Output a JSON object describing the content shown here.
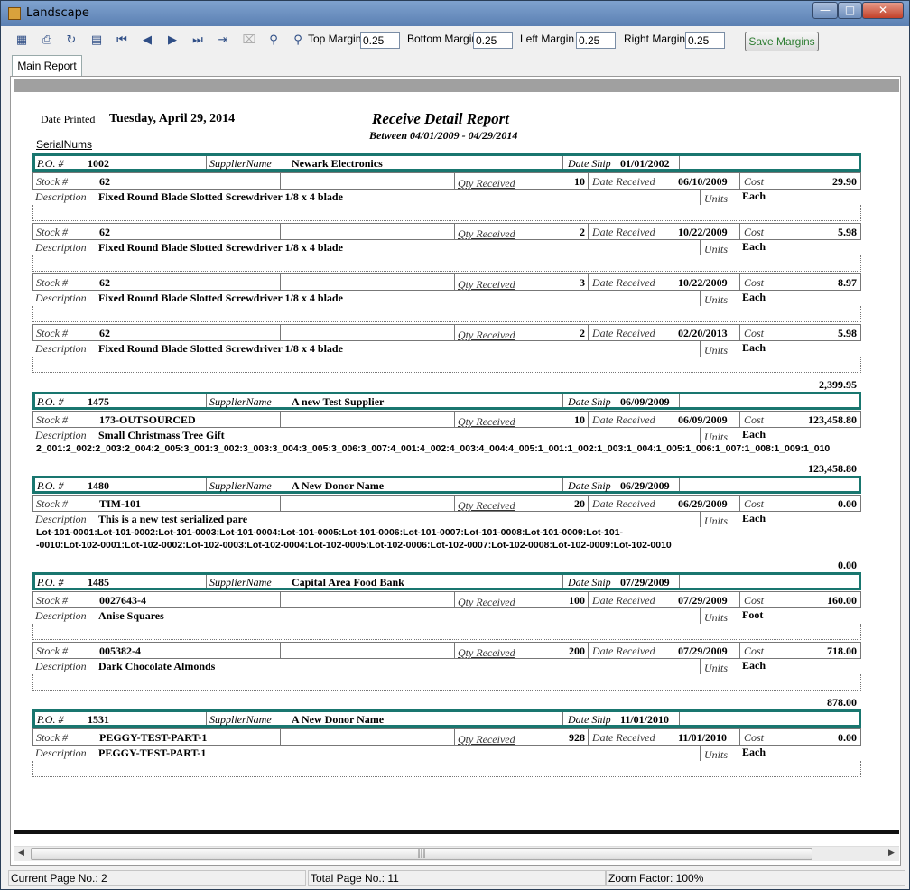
{
  "window": {
    "title": "Landscape"
  },
  "toolbar": {
    "top_margin_label": "Top Margin",
    "top_margin_value": "0.25",
    "bottom_margin_label": "Bottom Margin",
    "bottom_margin_value": "0.25",
    "left_margin_label": "Left Margin",
    "left_margin_value": "0.25",
    "right_margin_label": "Right Margin",
    "right_margin_value": "0.25",
    "save_label": "Save Margins",
    "icons": [
      "export-icon",
      "print-icon",
      "refresh-icon",
      "tree-icon",
      "first-page-icon",
      "prev-page-icon",
      "next-page-icon",
      "last-page-icon",
      "goto-icon",
      "stop-icon",
      "find-icon",
      "find-next-icon"
    ]
  },
  "tabs": [
    "Main Report"
  ],
  "report": {
    "date_printed_label": "Date Printed",
    "date_printed": "Tuesday, April 29, 2014",
    "title": "Receive Detail Report",
    "subtitle": "Between 04/01/2009 - 04/29/2014",
    "serial_label": "SerialNums",
    "labels": {
      "po": "P.O. #",
      "supplier": "SupplierName",
      "date_ship": "Date Ship",
      "stock": "Stock #",
      "qty": "Qty Received",
      "date_rec": "Date Received",
      "cost": "Cost",
      "desc": "Description",
      "units": "Units"
    },
    "pos": [
      {
        "po": "1002",
        "supplier": "Newark Electronics",
        "date_ship": "01/01/2002",
        "items": [
          {
            "stock": "62",
            "qty": "10",
            "date": "06/10/2009",
            "cost": "29.90",
            "desc": "Fixed Round Blade Slotted Screwdriver 1/8  x 4  blade",
            "units": "Each"
          },
          {
            "stock": "62",
            "qty": "2",
            "date": "10/22/2009",
            "cost": "5.98",
            "desc": "Fixed Round Blade Slotted Screwdriver 1/8  x 4  blade",
            "units": "Each"
          },
          {
            "stock": "62",
            "qty": "3",
            "date": "10/22/2009",
            "cost": "8.97",
            "desc": "Fixed Round Blade Slotted Screwdriver 1/8  x 4  blade",
            "units": "Each"
          },
          {
            "stock": "62",
            "qty": "2",
            "date": "02/20/2013",
            "cost": "5.98",
            "desc": "Fixed Round Blade Slotted Screwdriver 1/8  x 4  blade",
            "units": "Each"
          }
        ],
        "total": "2,399.95"
      },
      {
        "po": "1475",
        "supplier": "A new Test Supplier",
        "date_ship": "06/09/2009",
        "items": [
          {
            "stock": "173-OUTSOURCED",
            "qty": "10",
            "date": "06/09/2009",
            "cost": "123,458.80",
            "desc": "Small Christmass Tree Gift",
            "units": "Each",
            "serials": [
              "2_001:2_002:2_003:2_004:2_005:3_001:3_002:3_003:3_004:3_005:3_006:3_007:4_001:4_002:4_003:4_004:4_005:1_001:1_002:1_003:1_004:1_005:1_006:1_007:1_008:1_009:1_010"
            ]
          }
        ],
        "total": "123,458.80"
      },
      {
        "po": "1480",
        "supplier": "A New Donor Name",
        "date_ship": "06/29/2009",
        "items": [
          {
            "stock": "TIM-101",
            "qty": "20",
            "date": "06/29/2009",
            "cost": "0.00",
            "desc": "This is a new test serialized pare",
            "units": "Each",
            "serials": [
              "Lot-101-0001:Lot-101-0002:Lot-101-0003:Lot-101-0004:Lot-101-0005:Lot-101-0006:Lot-101-0007:Lot-101-0008:Lot-101-0009:Lot-101-",
              "-0010:Lot-102-0001:Lot-102-0002:Lot-102-0003:Lot-102-0004:Lot-102-0005:Lot-102-0006:Lot-102-0007:Lot-102-0008:Lot-102-0009:Lot-102-0010"
            ]
          }
        ],
        "total": "0.00"
      },
      {
        "po": "1485",
        "supplier": "Capital Area Food Bank",
        "date_ship": "07/29/2009",
        "items": [
          {
            "stock": "0027643-4",
            "qty": "100",
            "date": "07/29/2009",
            "cost": "160.00",
            "desc": "Anise Squares",
            "units": "Foot"
          },
          {
            "stock": "005382-4",
            "qty": "200",
            "date": "07/29/2009",
            "cost": "718.00",
            "desc": "Dark Chocolate Almonds",
            "units": "Each"
          }
        ],
        "total": "878.00"
      },
      {
        "po": "1531",
        "supplier": "A New Donor Name",
        "date_ship": "11/01/2010",
        "items": [
          {
            "stock": "PEGGY-TEST-PART-1",
            "qty": "928",
            "date": "11/01/2010",
            "cost": "0.00",
            "desc": "PEGGY-TEST-PART-1",
            "units": "Each"
          }
        ]
      }
    ]
  },
  "status": {
    "current_page": "Current Page No.: 2",
    "total_pages": "Total Page No.: 11",
    "zoom": "Zoom Factor: 100%"
  }
}
